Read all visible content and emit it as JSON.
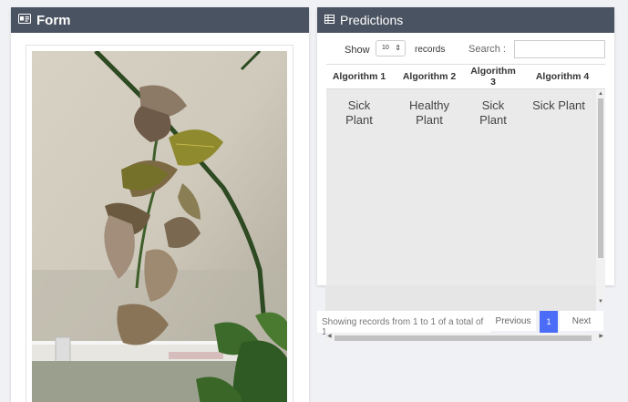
{
  "form_panel": {
    "title": "Form",
    "icon": "id-card-icon"
  },
  "predictions_panel": {
    "title": "Predictions",
    "icon": "table-icon",
    "show_label": "Show",
    "page_size": "10",
    "records_label": "records",
    "search_label": "Search :",
    "search_value": "",
    "columns": [
      "Algorithm 1",
      "Algorithm 2",
      "Algorithm 3",
      "Algorithm 4"
    ],
    "row": {
      "c1": [
        "Sick",
        "Plant"
      ],
      "c2": [
        "Healthy",
        "Plant"
      ],
      "c3": [
        "Sick",
        "Plant"
      ],
      "c4": [
        "Sick Plant"
      ]
    },
    "footer_info": "Showing records from 1 to 1 of a total of 1",
    "previous_label": "Previous",
    "current_page": "1",
    "next_label": "Next"
  },
  "colors": {
    "header_bg": "#4a5361",
    "accent": "#4a6cf7",
    "page_bg": "#f0f1f5"
  }
}
